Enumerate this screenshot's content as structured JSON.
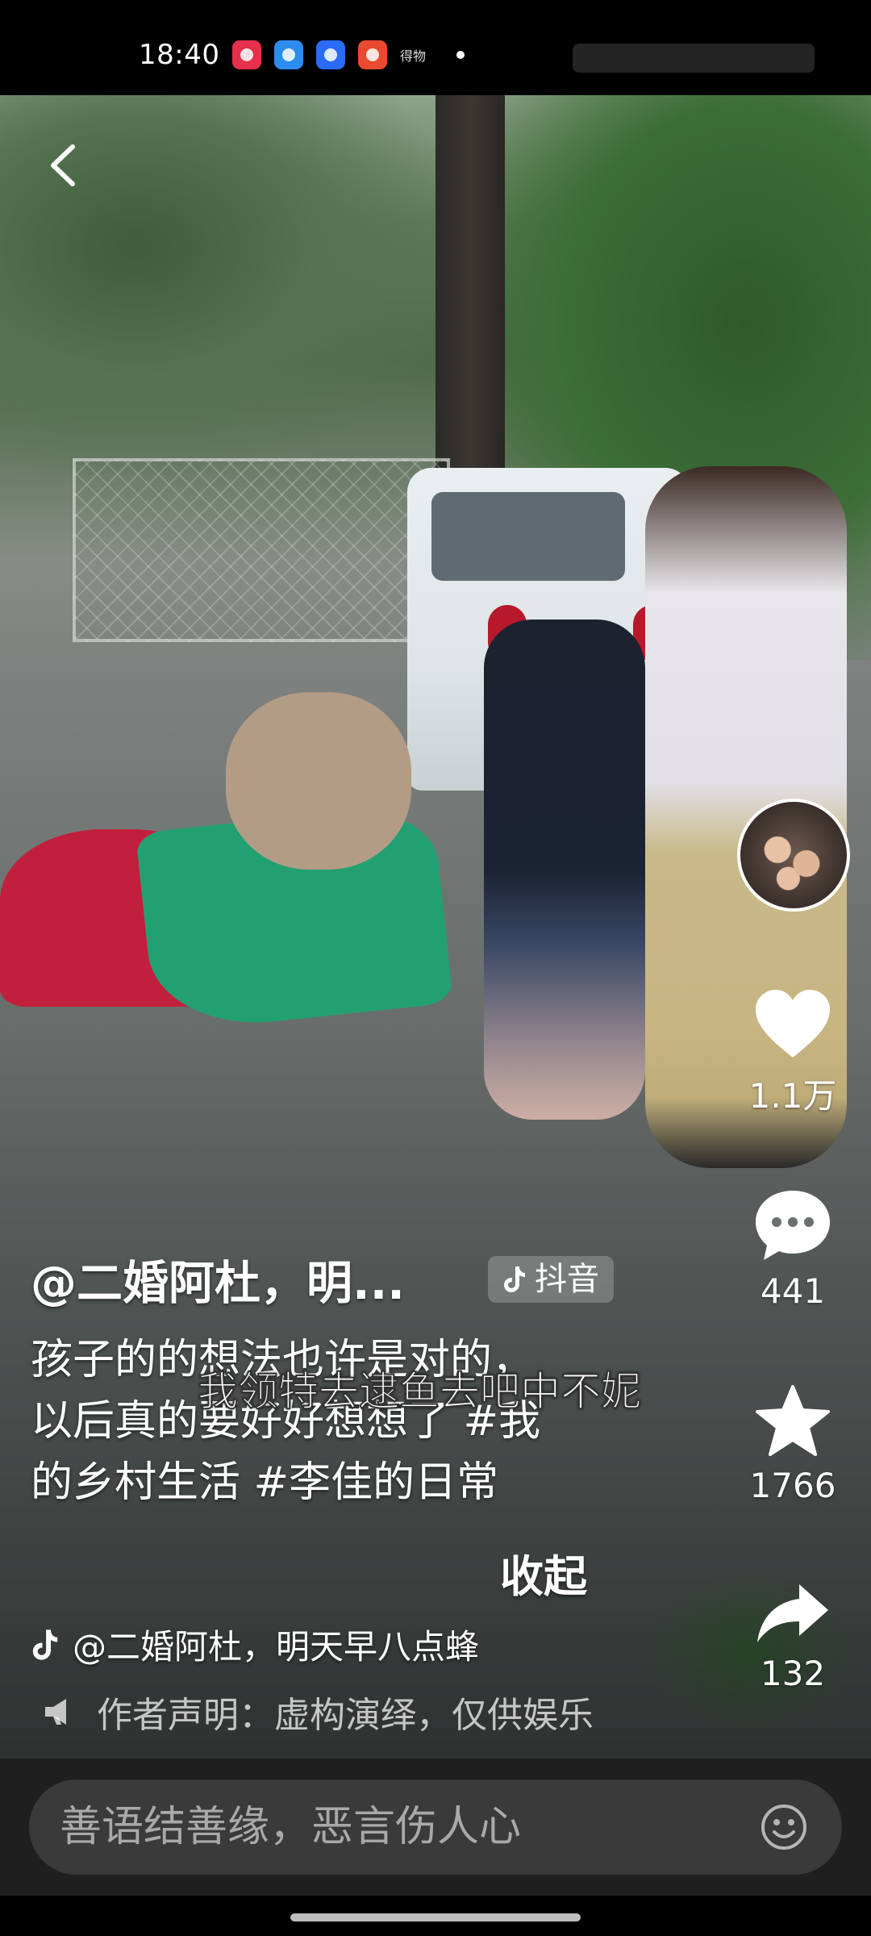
{
  "status_bar": {
    "time": "18:40",
    "apps": [
      "music-app",
      "weather-app",
      "files-app",
      "video-app"
    ],
    "small_text": "得物"
  },
  "video": {
    "author_handle": "@二婚阿杜，明...",
    "platform_badge": "抖音",
    "caption_lines": [
      "孩子的的想法也许是对的，",
      "以后真的要好好想想了 #我",
      "的乡村生活 #李佳的日常"
    ],
    "subtitle_overlay": "我领特去逮鱼去吧中不妮",
    "collapse_label": "收起",
    "music_text": "@二婚阿杜，明天早八点蜂",
    "disclaimer_text": "作者声明：虚构演绎，仅供娱乐"
  },
  "rail": {
    "likes": "1.1万",
    "comments": "441",
    "favorites": "1766",
    "shares": "132"
  },
  "comment_bar": {
    "placeholder": "善语结善缘，恶言伤人心"
  },
  "icons": {
    "back": "chevron-left-icon",
    "like": "heart-icon",
    "comment": "comment-bubble-icon",
    "favorite": "star-icon",
    "share": "share-arrow-icon",
    "emoji": "emoji-face-icon",
    "music": "tiktok-note-icon",
    "disclaimer": "megaphone-icon"
  },
  "colors": {
    "comment_bar_bg": "#1f1f1f",
    "comment_input_bg": "#3a3a3a",
    "placeholder_text": "#a9a9a9"
  }
}
